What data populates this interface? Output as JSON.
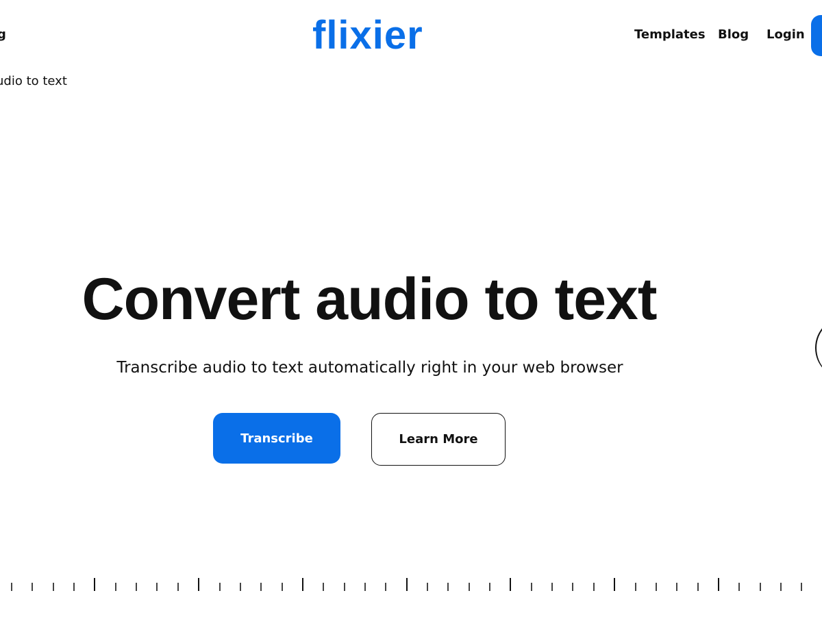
{
  "header": {
    "logo": "flixier",
    "partial_left": "g",
    "nav": [
      "Templates",
      "Blog",
      "Login"
    ]
  },
  "breadcrumb": "udio to text",
  "hero": {
    "title": "Convert audio to text",
    "subtitle": "Transcribe audio to text automatically right in your web browser",
    "primary": "Transcribe",
    "secondary": "Learn More"
  },
  "colors": {
    "accent": "#0a6fe8"
  }
}
